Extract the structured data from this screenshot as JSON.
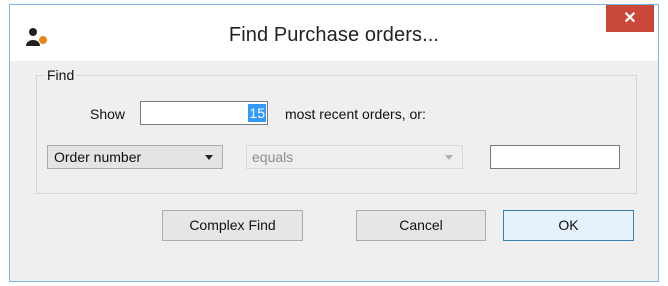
{
  "window": {
    "title": "Find Purchase orders...",
    "close_glyph": "✕",
    "icon": "mSupply-app-icon"
  },
  "find_group": {
    "label": "Find",
    "show_label": "Show",
    "show_value": "15",
    "recent_label": "most recent orders, or:",
    "field_select": {
      "selected": "Order number"
    },
    "operator_select": {
      "selected": "equals",
      "enabled": false
    },
    "value_input": {
      "value": ""
    }
  },
  "buttons": {
    "complex_find": "Complex Find",
    "cancel": "Cancel",
    "ok": "OK"
  },
  "colors": {
    "close_button": "#c9483a",
    "window_border": "#7eb4ea",
    "selection": "#3399ff",
    "default_button_border": "#3c7fb1"
  }
}
